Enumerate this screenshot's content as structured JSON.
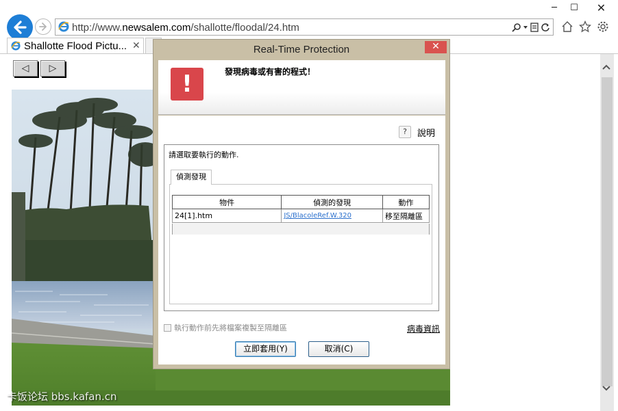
{
  "browser": {
    "window_controls": {
      "minimize": "─",
      "maximize": "☐",
      "close": "✕"
    },
    "address": {
      "prefix": "http://www.",
      "host": "newsalem.com",
      "path": "/shallotte/floodal/24.htm"
    },
    "tab": {
      "title": "Shallotte Flood Pictu...",
      "close": "✕"
    },
    "icons": [
      "home-icon",
      "favorites-star-icon",
      "settings-gear-icon",
      "search-icon",
      "compatibility-view-icon",
      "refresh-icon"
    ]
  },
  "page": {
    "nav": {
      "prev": "◁",
      "next": "▷"
    },
    "watermark": "卡饭论坛 bbs.kafan.cn"
  },
  "dialog": {
    "title": "Real-Time Protection",
    "close": "✕",
    "alert_icon": "!",
    "message": "發現病毒或有害的程式！",
    "help_icon": "?",
    "help_label": "說明",
    "action_prompt": "請選取要執行的動作.",
    "tab_label": "偵測發現",
    "table": {
      "headers": [
        "物件",
        "偵測的發現",
        "動作"
      ],
      "rows": [
        {
          "object": "24[1].htm",
          "detection": "JS/BlacoleRef.W.320",
          "action": "移至隔離區"
        }
      ]
    },
    "checkbox_label": "執行動作前先將檔案複製至隔離區",
    "virus_info": "病毒資訊",
    "buttons": {
      "apply": "立即套用(Y)",
      "cancel": "取消(C)"
    }
  },
  "colors": {
    "back_button": "#1e7ed6",
    "dialog_frame": "#c9bfa6",
    "alert": "#d9464b",
    "close_button": "#d9534f",
    "link": "#2a6fcc"
  }
}
